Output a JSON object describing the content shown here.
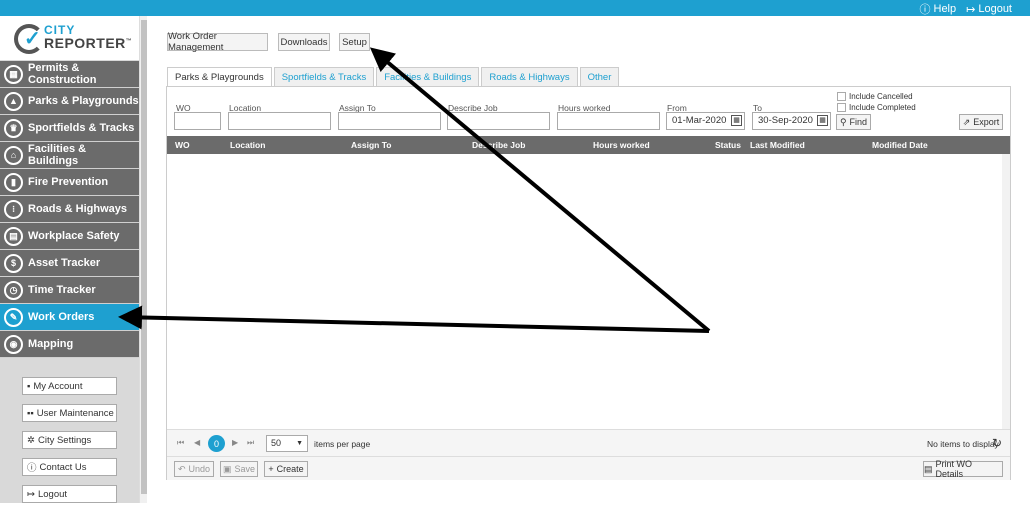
{
  "header": {
    "help_label": "Help",
    "logout_label": "Logout"
  },
  "logo": {
    "line1": "CITY",
    "line2": "REPORTER",
    "tm": "™"
  },
  "sidebar": {
    "items": [
      {
        "label": "Permits & Construction",
        "icon": "building-icon"
      },
      {
        "label": "Parks & Playgrounds",
        "icon": "tree-icon"
      },
      {
        "label": "Sportfields & Tracks",
        "icon": "trophy-icon"
      },
      {
        "label": "Facilities & Buildings",
        "icon": "facility-icon"
      },
      {
        "label": "Fire Prevention",
        "icon": "extinguisher-icon"
      },
      {
        "label": "Roads & Highways",
        "icon": "traffic-light-icon"
      },
      {
        "label": "Workplace Safety",
        "icon": "workplace-icon"
      },
      {
        "label": "Asset Tracker",
        "icon": "asset-icon"
      },
      {
        "label": "Time Tracker",
        "icon": "clock-icon"
      },
      {
        "label": "Work Orders",
        "icon": "work-orders-icon"
      },
      {
        "label": "Mapping",
        "icon": "map-icon"
      }
    ],
    "active": "Work Orders",
    "account_buttons": [
      {
        "label": "My Account",
        "icon": "user-icon"
      },
      {
        "label": "User Maintenance",
        "icon": "users-icon"
      },
      {
        "label": "City Settings",
        "icon": "gear-icon"
      },
      {
        "label": "Contact Us",
        "icon": "info-icon"
      },
      {
        "label": "Logout",
        "icon": "logout-icon"
      }
    ]
  },
  "top_tabs": {
    "work_order_management": "Work Order Management",
    "downloads": "Downloads",
    "setup": "Setup"
  },
  "sub_tabs": [
    "Parks & Playgrounds",
    "Sportfields & Tracks",
    "Facilities & Buildings",
    "Roads & Highways",
    "Other"
  ],
  "filters": {
    "wo_label": "WO",
    "location_label": "Location",
    "assign_label": "Assign To",
    "describe_label": "Describe Job",
    "hours_label": "Hours worked",
    "from_label": "From",
    "from_value": "01-Mar-2020",
    "to_label": "To",
    "to_value": "30-Sep-2020",
    "include_cancelled": "Include Cancelled",
    "include_completed": "Include Completed",
    "find_label": "Find",
    "export_label": "Export"
  },
  "grid": {
    "columns": [
      "WO",
      "Location",
      "Assign To",
      "Describe Job",
      "Hours worked",
      "Status",
      "Last Modified",
      "Modified Date"
    ]
  },
  "pager": {
    "page": "0",
    "page_size": "50",
    "items_per_page": "items per page",
    "no_items": "No items to display"
  },
  "toolbar": {
    "undo": "Undo",
    "save": "Save",
    "create": "Create",
    "print": "Print WO Details"
  },
  "colors": {
    "accent": "#1ea0d0",
    "nav_bg": "#6b6b6b",
    "sidebar_bg": "#d9d9d9"
  }
}
